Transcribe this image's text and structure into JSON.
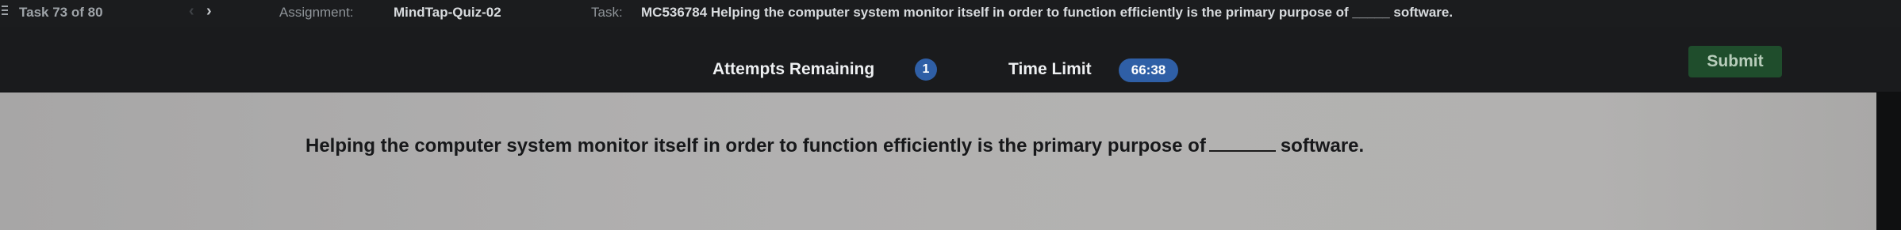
{
  "nav": {
    "task_progress": "Task 73 of 80",
    "prev_icon": "chevron-left-icon",
    "next_icon": "chevron-right-icon",
    "assignment_label": "Assignment:",
    "assignment_name": "MindTap-Quiz-02",
    "task_label": "Task:",
    "task_title": "MC536784 Helping the computer system monitor itself in order to function efficiently is the primary purpose of _____ software."
  },
  "status": {
    "attempts_label": "Attempts Remaining",
    "attempts_value": "1",
    "time_label": "Time Limit",
    "time_value": "66:38",
    "submit_label": "Submit"
  },
  "question": {
    "text_before": "Helping the computer system monitor itself in order to function efficiently is the primary purpose of",
    "text_after": "software."
  },
  "colors": {
    "badge": "#2f5fa6",
    "submit": "#1f4d2c",
    "card": "#b0afaf"
  }
}
